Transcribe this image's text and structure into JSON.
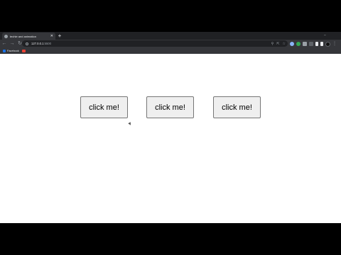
{
  "browser": {
    "tab": {
      "title": "techie and animation",
      "close": "✕",
      "favicon": "globe-icon"
    },
    "new_tab": "+",
    "window_controls": {
      "minimize": "–",
      "maximize": "□",
      "close": "✕"
    },
    "toolbar": {
      "back": "←",
      "forward": "→",
      "reload": "↻",
      "home": "⌂"
    },
    "address_bar": {
      "host": "127.0.0.1",
      "port": ":5500"
    },
    "bookmarks": [
      {
        "label": "Facebook",
        "icon": "facebook-icon"
      },
      {
        "label": "",
        "icon": "youtube-icon"
      }
    ]
  },
  "page": {
    "buttons": [
      "click me!",
      "click me!",
      "click me!"
    ]
  }
}
